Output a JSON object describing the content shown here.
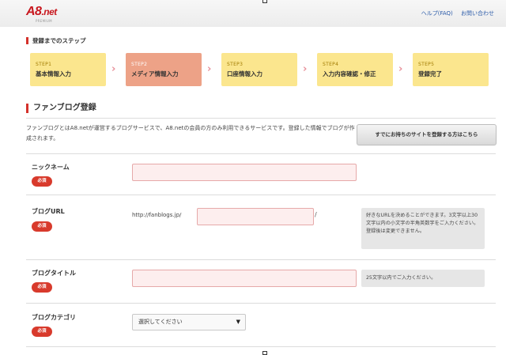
{
  "header": {
    "logo_main": "A8",
    "logo_ext": ".net",
    "logo_tagline": "PREMIUM",
    "links": [
      "ヘルプ(FAQ)",
      "お問い合わせ"
    ]
  },
  "steps_section": {
    "title": "登録までのステップ",
    "steps": [
      {
        "num": "STEP1",
        "label": "基本情報入力"
      },
      {
        "num": "STEP2",
        "label": "メディア情報入力"
      },
      {
        "num": "STEP3",
        "label": "口座情報入力"
      },
      {
        "num": "STEP4",
        "label": "入力内容確認・修正"
      },
      {
        "num": "STEP5",
        "label": "登録完了"
      }
    ],
    "arrow_glyph": "›"
  },
  "form": {
    "title": "ファンブログ登録",
    "description": "ファンブログとはA8.netが運営するブログサービスで、A8.netの会員の方のみ利用できるサービスです。登録した情報でブログが作成されます。",
    "existing_site_button": "すでにお持ちのサイトを登録する方はこちら",
    "required_badge": "必須",
    "fields": {
      "nickname": {
        "label": "ニックネーム",
        "value": ""
      },
      "blog_url": {
        "label": "ブログURL",
        "prefix": "http://fanblogs.jp/",
        "suffix": "/",
        "value": "",
        "hint": "好きなURLを決めることができます。3文字以上30文字以内の小文字の半角英数字をご入力ください。登録後は変更できません。"
      },
      "blog_title": {
        "label": "ブログタイトル",
        "value": "",
        "hint": "25文字以内でご入力ください。"
      },
      "blog_category": {
        "label": "ブログカテゴリ",
        "selected": "選択してください",
        "caret": "▼"
      }
    }
  }
}
